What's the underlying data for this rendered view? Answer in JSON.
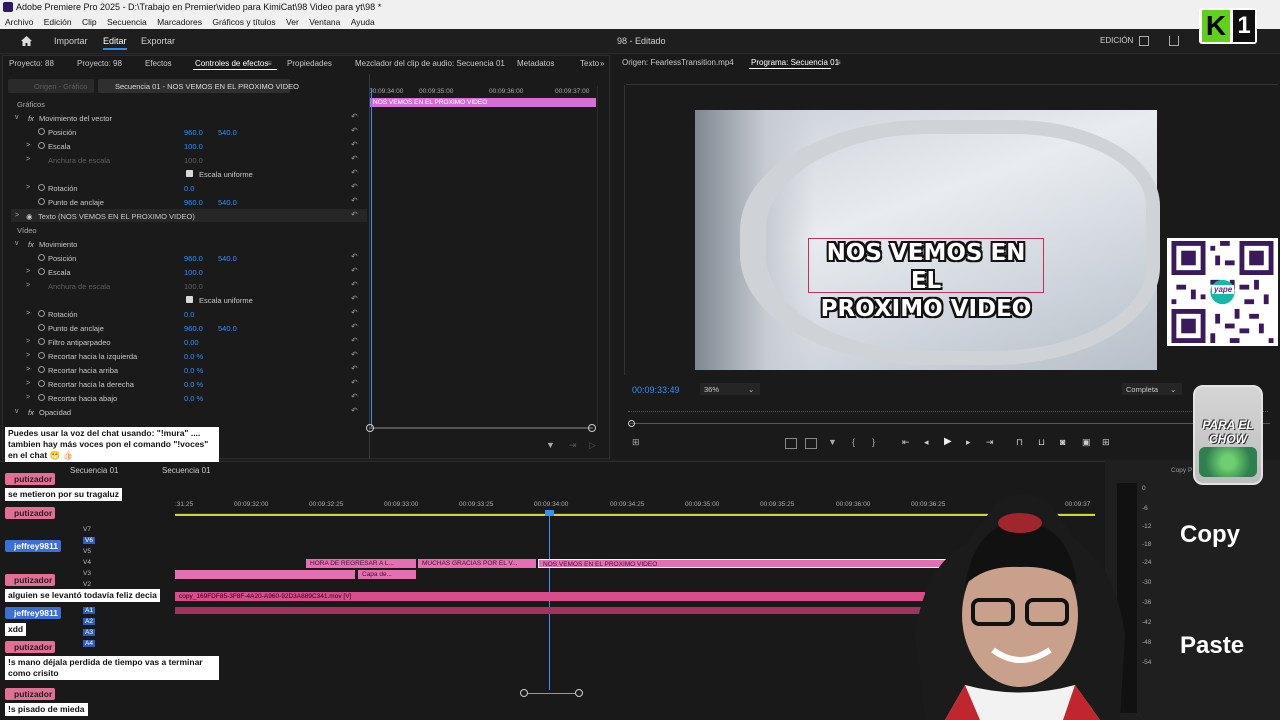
{
  "titlebar": {
    "text": "Adobe Premiere Pro 2025 - D:\\Trabajo en Premier\\video para KimiCat\\98 Video para yt\\98 *"
  },
  "menu": [
    "Archivo",
    "Edición",
    "Clip",
    "Secuencia",
    "Marcadores",
    "Gráficos y títulos",
    "Ver",
    "Ventana",
    "Ayuda"
  ],
  "workspace": {
    "home": "Inicio",
    "importar": "Importar",
    "editar": "Editar",
    "exportar": "Exportar",
    "project_title": "98 - Editado",
    "mode": "EDICIÓN"
  },
  "ec_tabs": [
    "Proyecto: 88",
    "Proyecto: 98",
    "Efectos",
    "Controles de efectos",
    "Propiedades",
    "Mezclador del clip de audio: Secuencia 01",
    "Metadatos",
    "Texto"
  ],
  "ec_source": {
    "origen": "Origen - Gráfico",
    "seq": "Secuencia 01 - NOS VEMOS EN EL PROXIMO VIDEO"
  },
  "ec_ruler": [
    "00:09:34:00",
    "00:09:35:00",
    "00:09:36:00",
    "00:09:37:00"
  ],
  "ec_clip": "NOS VEMOS EN EL PROXIMO VIDEO",
  "graficos": {
    "title": "Gráficos",
    "mov_vector": "Movimiento del vector",
    "posicion": "Posición",
    "pos_x": "960.0",
    "pos_y": "540.0",
    "escala": "Escala",
    "escala_val": "100.0",
    "anchura": "Anchura de escala",
    "anchura_val": "100.0",
    "uniforme": "Escala uniforme",
    "rotacion": "Rotación",
    "rot_val": "0.0",
    "anclaje": "Punto de anclaje",
    "anc_x": "960.0",
    "anc_y": "540.0",
    "texto": "Texto (NOS VEMOS EN EL PROXIMO VIDEO)"
  },
  "video": {
    "title": "Vídeo",
    "movimiento": "Movimiento",
    "posicion": "Posición",
    "pos_x": "960.0",
    "pos_y": "540.0",
    "escala": "Escala",
    "escala_val": "100.0",
    "anchura": "Anchura de escala",
    "anchura_val": "100.0",
    "uniforme": "Escala uniforme",
    "rotacion": "Rotación",
    "rot_val": "0.0",
    "anclaje": "Punto de anclaje",
    "anc_x": "960.0",
    "anc_y": "540.0",
    "filtro": "Filtro antiparpadeo",
    "filtro_val": "0.00",
    "rec_izq": "Recortar hacia la izquierda",
    "rec_izq_val": "0.0 %",
    "rec_arr": "Recortar hacia arriba",
    "rec_arr_val": "0.0 %",
    "rec_der": "Recortar hacia la derecha",
    "rec_der_val": "0.0 %",
    "rec_aba": "Recortar hacia abajo",
    "rec_aba_val": "0.0 %",
    "opacidad": "Opacidad"
  },
  "program": {
    "origen_tab": "Origen: FearlessTransition.mp4",
    "programa_tab": "Programa: Secuencia 01",
    "timecode": "00:09:33:49",
    "zoom": "36%",
    "quality": "Completa",
    "caption_line1": "NOS VEMOS EN EL",
    "caption_line2": "PROXIMO VIDEO"
  },
  "timeline": {
    "seq_tab": "Secuencia 01",
    "ruler": [
      "00:09:32:00",
      "00:09:32:25",
      "00:09:33:00",
      "00:09:33:25",
      "00:09:34:00",
      "00:09:34:25",
      "00:09:35:00",
      "00:09:35:25",
      "00:09:36:00",
      "00:09:36:25",
      "00:09:37"
    ],
    "ruler_start": ":31:25",
    "tracks": [
      "V7",
      "V6",
      "V5",
      "V4",
      "V3",
      "V2",
      "V1",
      "A1",
      "A2",
      "A3",
      "A4"
    ],
    "clips": {
      "c1": "HORA DE REGRESAR A L...",
      "c2": "MUCHAS GRACIAS POR EL V...",
      "c3": "NOS VEMOS EN EL PROXIMO VIDEO",
      "c4": "Capa de...",
      "c5": "copy_169FDF85-3F8F-4A20-A960-92D3A889C341.mov [V]"
    }
  },
  "chat": [
    {
      "type": "text",
      "text": "Puedes usar la voz del chat usando: \"!mura\" .... tambien hay más voces pon el comando \"!voces\" en el chat 😁 👍🏻"
    },
    {
      "type": "name",
      "text": "putizador"
    },
    {
      "type": "text",
      "text": "se metieron por su tragaluz"
    },
    {
      "type": "name",
      "text": "putizador"
    },
    {
      "type": "name",
      "text": "jeffrey9811"
    },
    {
      "type": "name",
      "text": "putizador"
    },
    {
      "type": "text",
      "text": "alguien se levantó todavía feliz decia"
    },
    {
      "type": "name",
      "text": "jeffrey9811"
    },
    {
      "type": "text",
      "text": "xdd"
    },
    {
      "type": "name",
      "text": "putizador"
    },
    {
      "type": "text",
      "text": "!s mano déjala perdida de tiempo vas a terminar como crisito"
    },
    {
      "type": "name",
      "text": "putizador"
    },
    {
      "type": "text",
      "text": "!s pisado de mieda"
    }
  ],
  "overlay": {
    "copy": "Copy",
    "paste": "Paste",
    "jar": "PARA EL CHOW",
    "logo_k": "K",
    "logo_1": "1",
    "qr_label": "yape",
    "copy_small": "Copy P"
  },
  "meter": [
    "0",
    "-6",
    "-12",
    "-18",
    "-24",
    "-30",
    "-36",
    "-42",
    "-48",
    "-54"
  ]
}
